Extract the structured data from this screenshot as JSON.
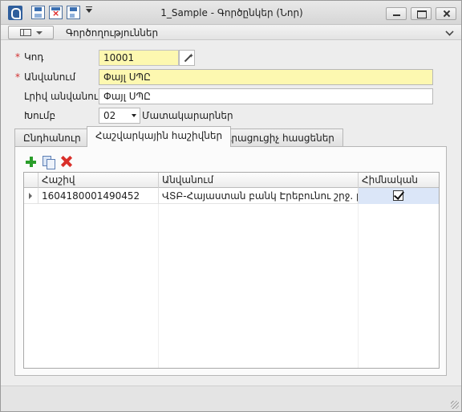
{
  "window": {
    "title": "1_Sample - Գործընկեր (Նոր)"
  },
  "ribbon": {
    "label": "Գործողություններ"
  },
  "form": {
    "code_label": "Կոդ",
    "code_value": "10001",
    "name_label": "Անվանում",
    "name_value": "Փայլ ՍՊԸ",
    "fullname_label": "Լրիվ անվանում",
    "fullname_value": "Փայլ ՍՊԸ",
    "group_label": "Խումբ",
    "group_value": "02",
    "group_name": "Մատակարարներ",
    "required_mark": "*"
  },
  "tabs": [
    {
      "label": "Ընդհանուր"
    },
    {
      "label": "Հաշվարկային հաշիվներ"
    },
    {
      "label": "Լրացուցիչ հասցեներ"
    }
  ],
  "grid": {
    "columns": [
      "Հաշիվ",
      "Անվանում",
      "Հիմնական"
    ],
    "rows": [
      {
        "account": "1604180001490452",
        "name": "ՎՏԲ-Հայաստան բանկ Էրեբունու շրջ. բ...",
        "main": true
      }
    ]
  },
  "icons": {
    "add": "plus-icon",
    "copy": "copy-icon",
    "delete": "delete-icon"
  },
  "colors": {
    "required_field_bg": "#fdf8b0",
    "required_star": "#d23030",
    "selected_cell_bg": "#dbe6f8"
  }
}
